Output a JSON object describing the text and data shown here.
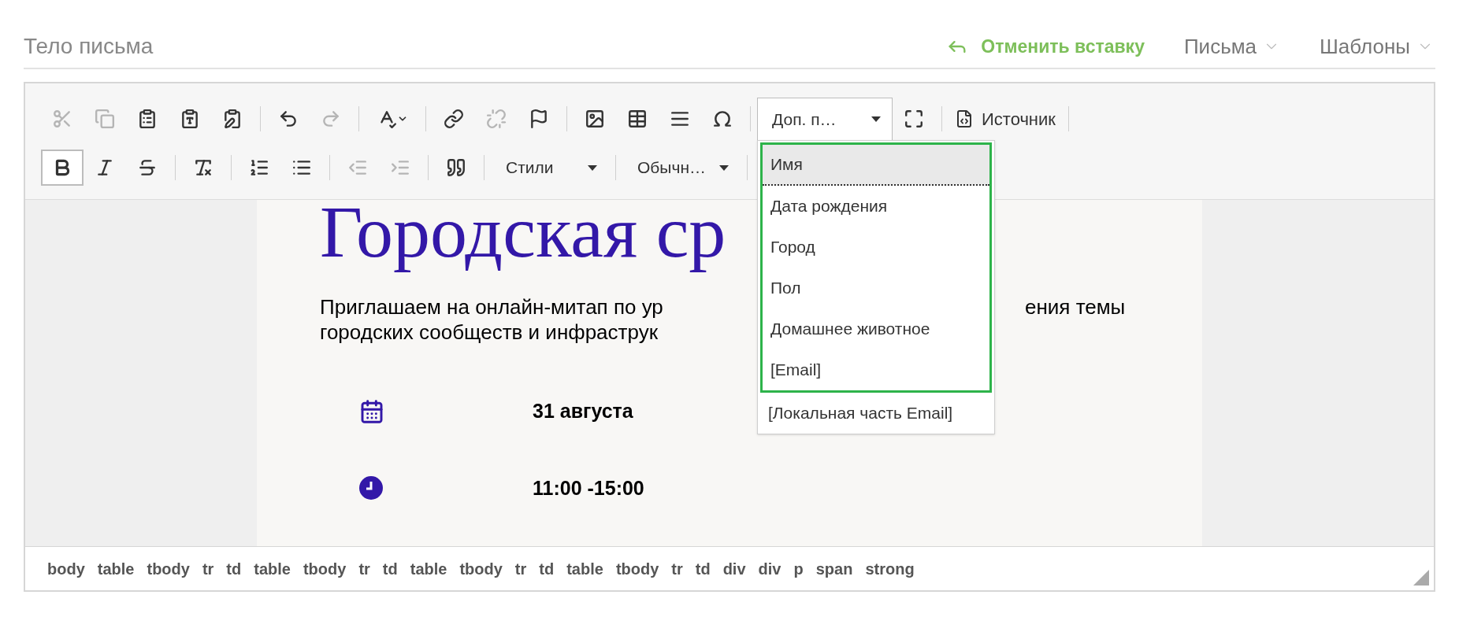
{
  "header": {
    "title": "Тело письма",
    "undo_insert": "Отменить вставку",
    "menus": [
      {
        "label": "Письма"
      },
      {
        "label": "Шаблоны"
      }
    ]
  },
  "toolbar": {
    "row_1": [
      {
        "kind": "button",
        "disabled": true
      },
      {
        "kind": "button",
        "disabled": true
      },
      {
        "kind": "button",
        "disabled": false
      },
      {
        "kind": "button",
        "disabled": false
      },
      {
        "kind": "button",
        "disabled": false
      },
      {
        "kind": "separator"
      },
      {
        "kind": "button",
        "disabled": false
      },
      {
        "kind": "button",
        "disabled": true
      },
      {
        "kind": "separator"
      },
      {
        "kind": "button",
        "disabled": false
      },
      {
        "kind": "separator"
      },
      {
        "kind": "button",
        "disabled": false
      },
      {
        "kind": "button",
        "disabled": true
      },
      {
        "kind": "button",
        "disabled": false
      },
      {
        "kind": "separator"
      },
      {
        "kind": "button",
        "disabled": false
      },
      {
        "kind": "button",
        "disabled": false
      },
      {
        "kind": "button",
        "disabled": false
      },
      {
        "kind": "button",
        "disabled": false
      },
      {
        "kind": "separator"
      },
      {
        "kind": "combo",
        "label": "Доп. п…",
        "open": true
      },
      {
        "kind": "button",
        "disabled": false
      },
      {
        "kind": "separator"
      },
      {
        "kind": "labeled",
        "label": "Источник",
        "disabled": false
      },
      {
        "kind": "separator"
      }
    ],
    "row_2": [
      {
        "kind": "button",
        "disabled": false,
        "pressed": true
      },
      {
        "kind": "button",
        "disabled": false,
        "pressed": false
      },
      {
        "kind": "button",
        "disabled": false,
        "pressed": false
      },
      {
        "kind": "separator"
      },
      {
        "kind": "button",
        "disabled": false,
        "pressed": false
      },
      {
        "kind": "separator"
      },
      {
        "kind": "button",
        "disabled": false,
        "pressed": false
      },
      {
        "kind": "button",
        "disabled": false,
        "pressed": false
      },
      {
        "kind": "separator"
      },
      {
        "kind": "button",
        "disabled": true,
        "pressed": false
      },
      {
        "kind": "button",
        "disabled": true,
        "pressed": false
      },
      {
        "kind": "separator"
      },
      {
        "kind": "button",
        "disabled": false,
        "pressed": false
      },
      {
        "kind": "separator"
      },
      {
        "kind": "combo",
        "label": "Стили",
        "open": false
      },
      {
        "kind": "separator"
      },
      {
        "kind": "combo",
        "label": "Обычн…",
        "open": false
      },
      {
        "kind": "separator"
      }
    ]
  },
  "dropdown": {
    "items": [
      {
        "label": "Имя",
        "selected": true
      },
      {
        "label": "Дата рождения",
        "selected": false
      },
      {
        "label": "Город",
        "selected": false
      },
      {
        "label": "Пол",
        "selected": false
      },
      {
        "label": "Домашнее животное",
        "selected": false
      },
      {
        "label": "[Email]",
        "selected": false
      },
      {
        "label": "[Локальная часть Email]",
        "selected": false
      }
    ]
  },
  "content": {
    "heading": "Городская ср",
    "paragraph": {
      "line_1_left": "Приглашаем на онлайн-митап по ур",
      "line_1_right": "ения темы",
      "line_2": "городских сообществ и инфраструк"
    },
    "details": [
      {
        "kind": "date",
        "text": "31 августа"
      },
      {
        "kind": "time",
        "text": "11:00 -15:00"
      }
    ]
  },
  "path_bar": [
    "body",
    "table",
    "tbody",
    "tr",
    "td",
    "table",
    "tbody",
    "tr",
    "td",
    "table",
    "tbody",
    "tr",
    "td",
    "table",
    "tbody",
    "tr",
    "td",
    "div",
    "div",
    "p",
    "span",
    "strong"
  ]
}
